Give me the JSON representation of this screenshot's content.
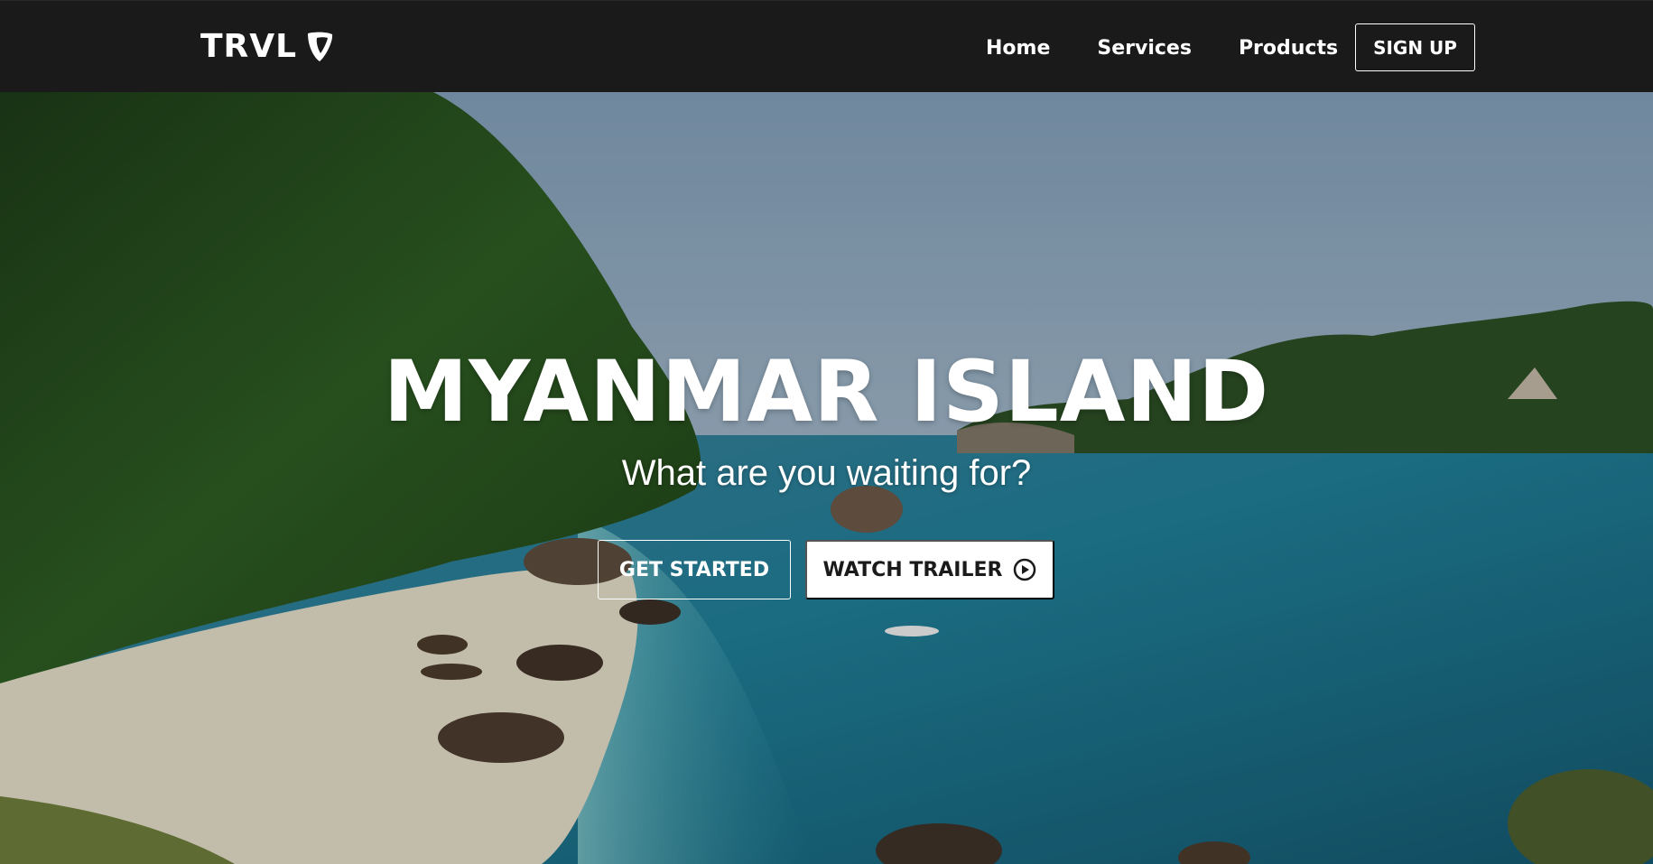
{
  "navbar": {
    "logo_text": "TRVL",
    "logo_icon": "typo3-icon",
    "links": [
      {
        "label": "Home"
      },
      {
        "label": "Services"
      },
      {
        "label": "Products"
      }
    ],
    "signup_label": "SIGN UP"
  },
  "hero": {
    "title": "MYANMAR ISLAND",
    "subtitle": "What are you waiting for?",
    "get_started_label": "GET STARTED",
    "watch_trailer_label": "WATCH TRAILER",
    "watch_trailer_icon": "play-circle-icon"
  },
  "colors": {
    "navbar_bg": "#1a1a1a",
    "text": "#ffffff",
    "button_solid_bg": "#ffffff",
    "button_solid_text": "#1a1a1a"
  }
}
